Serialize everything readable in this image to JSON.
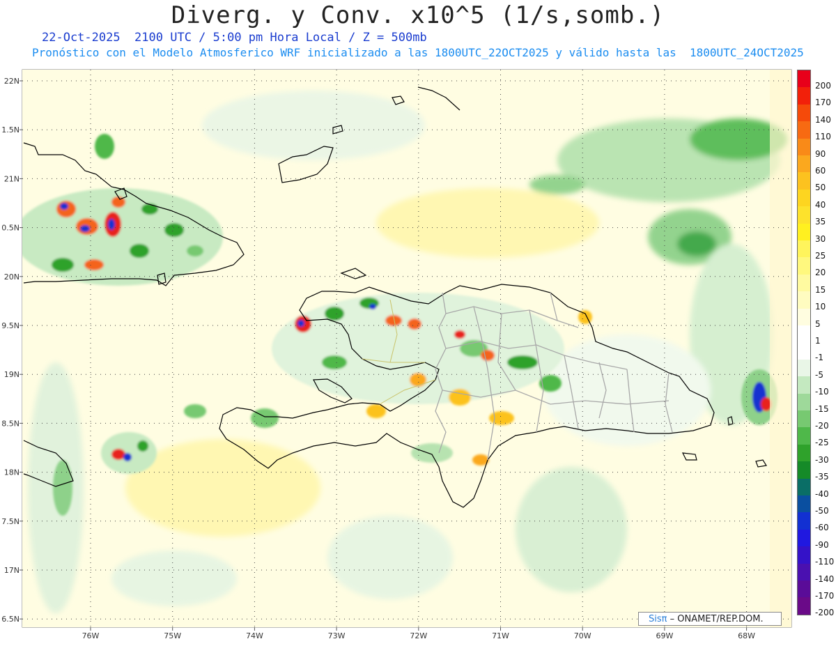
{
  "header": {
    "title": "Diverg. y Conv. x10^5 (1/s,somb.)",
    "subtitle_date": "22-Oct-2025  2100 UTC / 5:00 pm Hora Local / Z = 500mb",
    "subtitle_model": "Pronóstico con el Modelo Atmosferico WRF inicializado a las 1800UTC_22OCT2025 y válido hasta las  1800UTC_24OCT2025"
  },
  "axes": {
    "lat_labels": [
      "22N",
      "1.5N",
      "21N",
      "0.5N",
      "20N",
      "9.5N",
      "19N",
      "8.5N",
      "18N",
      "7.5N",
      "17N",
      "6.5N"
    ],
    "lon_labels": [
      "76W",
      "75W",
      "74W",
      "73W",
      "72W",
      "71W",
      "70W",
      "69W",
      "68W"
    ]
  },
  "colorbar": {
    "levels": [
      "200",
      "170",
      "140",
      "110",
      "90",
      "60",
      "50",
      "40",
      "35",
      "30",
      "25",
      "20",
      "15",
      "10",
      "5",
      "1",
      "-1",
      "-5",
      "-10",
      "-15",
      "-20",
      "-25",
      "-30",
      "-35",
      "-40",
      "-50",
      "-60",
      "-90",
      "-110",
      "-140",
      "-170",
      "-200"
    ],
    "colors": [
      "#e8001a",
      "#f2200a",
      "#f54a0a",
      "#f76a12",
      "#f98a18",
      "#fba81e",
      "#fcc21f",
      "#fdd520",
      "#fde22c",
      "#fff020",
      "#fff45c",
      "#fff87e",
      "#fffaa0",
      "#fffcc0",
      "#fffde0",
      "#ffffff",
      "#ffffff",
      "#e9f6e7",
      "#c4e9c0",
      "#9ed99a",
      "#77c971",
      "#4fb84a",
      "#2fa22b",
      "#158a28",
      "#0a6e66",
      "#0a4fa0",
      "#1230d2",
      "#2018e0",
      "#3412c8",
      "#4a10b0",
      "#5a0c98",
      "#6a0a88"
    ]
  },
  "credit": {
    "logo": "Sisπ",
    "text": "– ONAMET/REP.DOM."
  },
  "colors": {
    "coast": "#000000",
    "provinces": "#a8a8a8",
    "grid": "#333333"
  }
}
